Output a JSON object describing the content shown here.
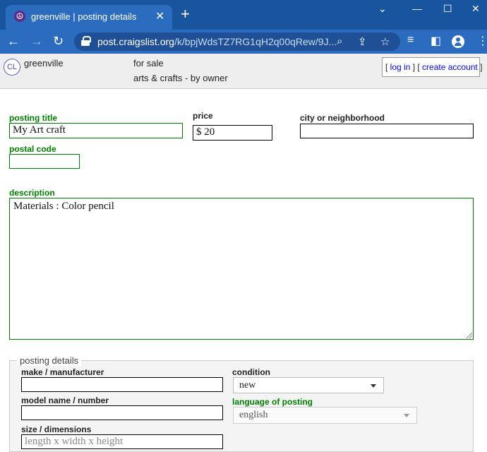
{
  "browser": {
    "tab_title": "greenville | posting details",
    "tab_close": "✕",
    "new_tab": "+",
    "url_host": "post.craigslist.org",
    "url_path": "/k/bpjWdsTZ7RG1qH2q00qRew/9J..."
  },
  "header": {
    "logo": "CL",
    "area": "greenville",
    "category_type": "for sale",
    "category": "arts & crafts - by owner",
    "account": {
      "open_bracket": "[ ",
      "login": "log in",
      "separator": " ] [ ",
      "create": "create account",
      "close_bracket": " ]"
    }
  },
  "form": {
    "posting_title": {
      "label": "posting title",
      "value": "My Art craft"
    },
    "price": {
      "label": "price",
      "value": "$ 20"
    },
    "city": {
      "label": "city or neighborhood",
      "value": ""
    },
    "postal_code": {
      "label": "postal code",
      "value": ""
    },
    "description": {
      "label": "description",
      "value": "Materials : Color pencil"
    }
  },
  "details": {
    "legend": "posting details",
    "make": {
      "label": "make / manufacturer",
      "value": ""
    },
    "model": {
      "label": "model name / number",
      "value": ""
    },
    "size": {
      "label": "size / dimensions",
      "placeholder": "length x width x height"
    },
    "condition": {
      "label": "condition",
      "value": "new"
    },
    "language": {
      "label": "language of posting",
      "value": "english"
    }
  },
  "colors": {
    "chrome_dark": "#19549f",
    "chrome": "#2b6cbf",
    "required_label": "#008000",
    "link": "#0000ee"
  }
}
